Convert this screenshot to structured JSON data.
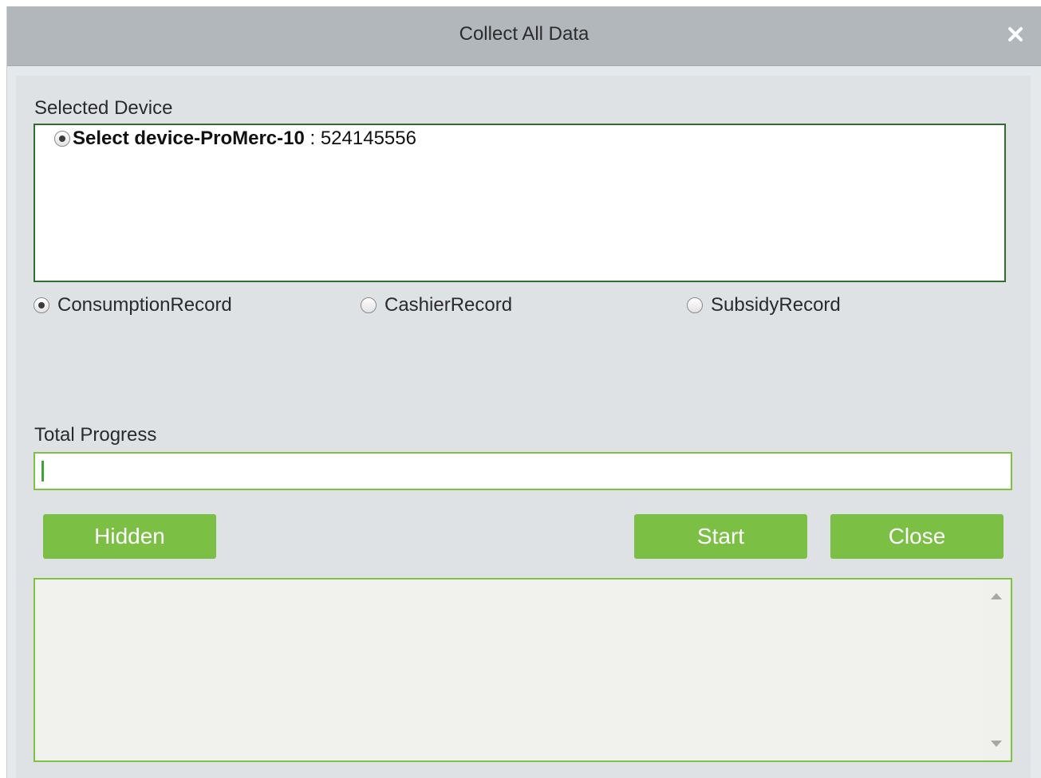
{
  "dialog": {
    "title": "Collect All Data",
    "close_icon": "close-x-icon"
  },
  "selected_device": {
    "label": "Selected Device",
    "devices": [
      {
        "name": "Select device-ProMerc-10",
        "separator": " : ",
        "serial": "524145556",
        "selected": true
      }
    ]
  },
  "record_types": [
    {
      "label": "ConsumptionRecord",
      "selected": true
    },
    {
      "label": "CashierRecord",
      "selected": false
    },
    {
      "label": "SubsidyRecord",
      "selected": false
    }
  ],
  "progress": {
    "label": "Total Progress",
    "value_fraction": 0.002,
    "fill_color": "#3aa53a",
    "border_color": "#7dc242"
  },
  "buttons": {
    "hidden_label": "Hidden",
    "start_label": "Start",
    "close_label": "Close",
    "color": "#7bbf44"
  },
  "log": {
    "scroll_up_icon": "scroll-up-arrow-icon",
    "scroll_down_icon": "scroll-down-arrow-icon"
  }
}
